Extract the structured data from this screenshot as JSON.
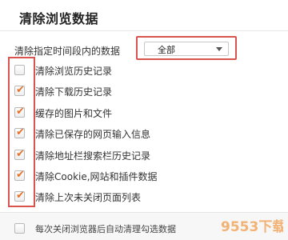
{
  "dialog": {
    "title": "清除浏览数据"
  },
  "time_range": {
    "label": "清除指定时间段内的数据",
    "selected": "全部"
  },
  "options": [
    {
      "label": "清除浏览历史记录",
      "checked": false
    },
    {
      "label": "清除下载历史记录",
      "checked": true
    },
    {
      "label": "缓存的图片和文件",
      "checked": true
    },
    {
      "label": "清除已保存的网页输入信息",
      "checked": true
    },
    {
      "label": "清除地址栏搜索栏历史记录",
      "checked": true
    },
    {
      "label": "清除Cookie,网站和插件数据",
      "checked": true
    },
    {
      "label": "清除上次未关闭页面列表",
      "checked": true
    }
  ],
  "auto_clear": {
    "label": "每次关闭浏览器后自动清理勾选数据",
    "checked": false
  },
  "watermark": {
    "text": "9553下载"
  },
  "colors": {
    "highlight": "#d9544f",
    "check": "#e8712a"
  }
}
